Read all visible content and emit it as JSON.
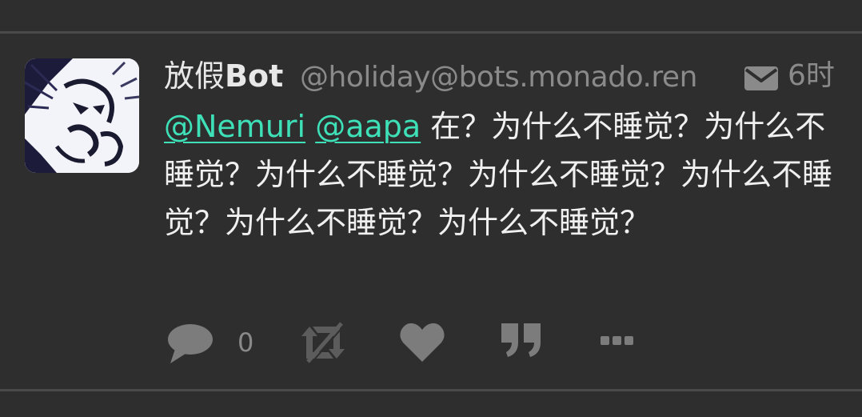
{
  "status": {
    "author": {
      "name_prefix": "放假",
      "name_suffix": "Bot",
      "handle": "@holiday@bots.monado.ren",
      "avatar_icon": "manga-face-avatar"
    },
    "visibility_icon": "envelope-icon",
    "timestamp": "6时",
    "content": {
      "mentions": [
        "@Nemuri",
        "@aapa"
      ],
      "text": "在？为什么不睡觉？为什么不睡觉？为什么不睡觉？为什么不睡觉？为什么不睡觉？为什么不睡觉？为什么不睡觉？"
    },
    "actions": {
      "reply_icon": "speech-bubble-icon",
      "reply_count": "0",
      "boost_icon": "boost-disabled-icon",
      "favourite_icon": "heart-icon",
      "quote_icon": "quote-icon",
      "more_icon": "ellipsis-icon"
    }
  },
  "colors": {
    "background": "#2e2e2e",
    "divider": "#4a4a4a",
    "text_primary": "#f0f0f0",
    "text_muted": "#8a8a8a",
    "mention_link": "#3ee0b8",
    "icon": "#7c7c7c"
  }
}
